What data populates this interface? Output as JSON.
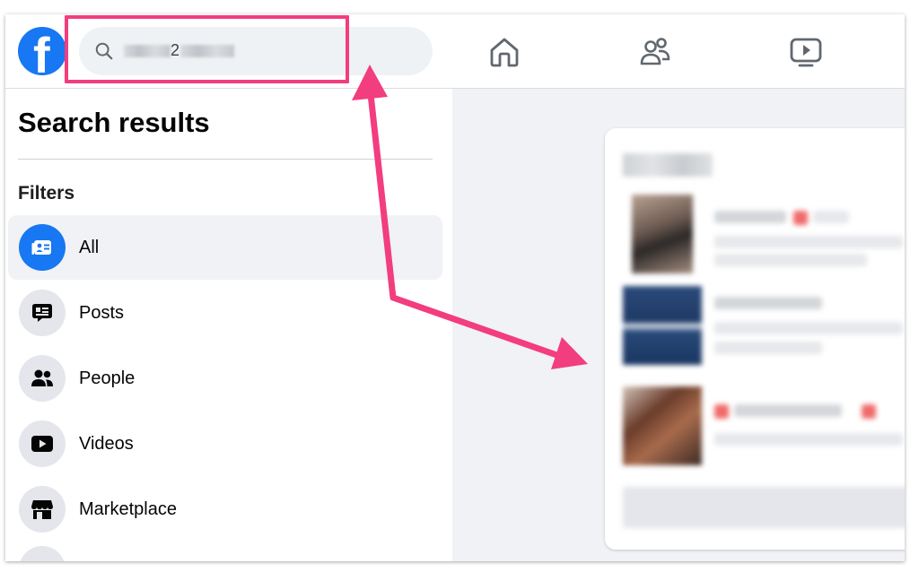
{
  "header": {
    "logo_letter": "f",
    "search": {
      "visible_text": "2"
    },
    "nav": [
      "home-icon",
      "friends-icon",
      "video-icon"
    ]
  },
  "sidebar": {
    "title": "Search results",
    "filters_heading": "Filters",
    "filters": [
      {
        "label": "All",
        "icon": "all-results-icon",
        "active": true
      },
      {
        "label": "Posts",
        "icon": "posts-icon",
        "active": false
      },
      {
        "label": "People",
        "icon": "people-icon",
        "active": false
      },
      {
        "label": "Videos",
        "icon": "videos-icon",
        "active": false
      },
      {
        "label": "Marketplace",
        "icon": "marketplace-icon",
        "active": false
      }
    ]
  },
  "colors": {
    "brand_blue": "#1877f2",
    "annotation_pink": "#f23d7e",
    "sidebar_active_bg": "#f0f2f5",
    "icon_circle_bg": "#e4e6eb",
    "main_bg": "#f0f2f5"
  }
}
